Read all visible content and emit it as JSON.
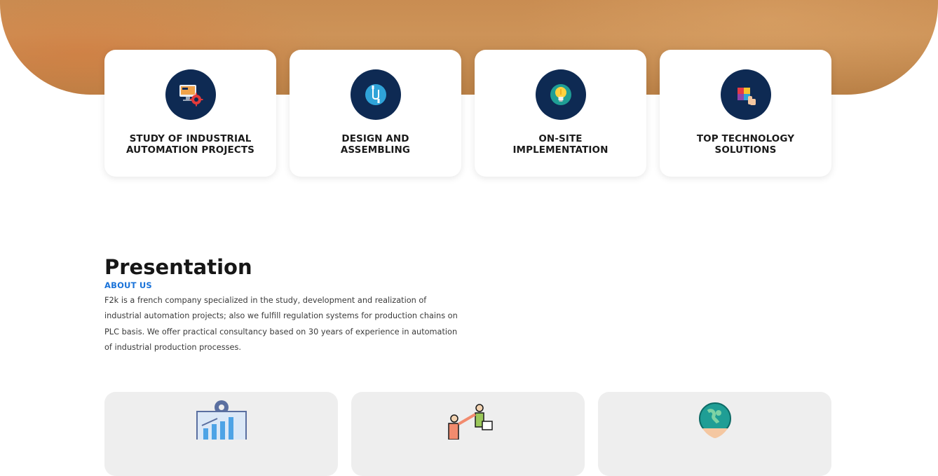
{
  "services": [
    {
      "title": "STUDY OF INDUSTRIAL AUTOMATION PROJECTS",
      "icon": "computer-gear-icon"
    },
    {
      "title": "DESIGN AND ASSEMBLING",
      "icon": "cable-plug-icon"
    },
    {
      "title": "ON-SITE IMPLEMENTATION",
      "icon": "lightbulb-icon"
    },
    {
      "title": "TOP TECHNOLOGY SOLUTIONS",
      "icon": "puzzle-hand-icon"
    }
  ],
  "presentation": {
    "heading": "Presentation",
    "label": "ABOUT US",
    "text": "F2k is a french company specialized in the study, development and realization of industrial automation projects; also we fulfill regulation systems for production chains on PLC basis. We offer practical consultancy based on 30 years of experience in automation of industrial production processes."
  },
  "features": [
    {
      "icon": "chart-gear-icon"
    },
    {
      "icon": "teamwork-icon"
    },
    {
      "icon": "globe-hands-icon"
    }
  ],
  "colors": {
    "accent": "#1a73d9",
    "icon_circle": "#0e2a53",
    "hero": "#c78a4f"
  }
}
